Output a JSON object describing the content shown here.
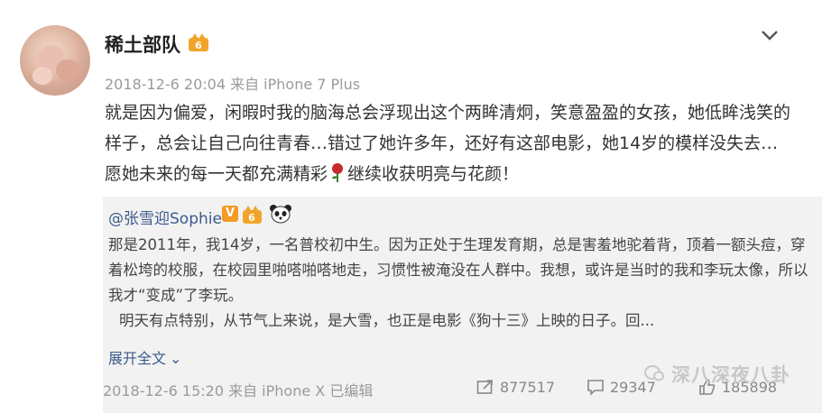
{
  "post": {
    "username": "稀土部队",
    "meta": "2018-12-6 20:04 来自 iPhone 7 Plus",
    "content_before_rose": "就是因为偏爱，闲暇时我的脑海总会浮现出这个两眸清炯，笑意盈盈的女孩，她低眸浅笑的样子，总会让自己向往青春…错过了她许多年，还好有这部电影，她14岁的模样没失去…愿她未来的每一天都充满精彩",
    "content_after_rose": "继续收获明亮与花颜！",
    "icons": [
      "vip-icon",
      "chevron-down-icon",
      "rose-icon"
    ]
  },
  "repost": {
    "username": "@张雪迎Sophie",
    "v_badge": "V",
    "text_1": "那是2011年，我14岁，一名普校初中生。因为正处于生理发育期，总是害羞地驼着背，顶着一额头痘，穿着松垮的校服，在校园里啪嗒啪嗒地走，习惯性被淹没在人群中。我想，或许是当时的我和李玩太像，所以我才“变成”了李玩。",
    "text_2": "明天有点特别，从节气上来说，是大雪，也正是电影《狗十三》上映的日子。回...",
    "expand_label": "展开全文",
    "expand_arrow": "⌄",
    "meta": "2018-12-6 15:20 来自 iPhone X  已编辑",
    "reposts": "877517",
    "comments": "29347",
    "likes": "185898",
    "watermark": "深八深夜八卦",
    "icons": [
      "vip-icon",
      "panda-icon",
      "repost-icon",
      "comment-icon",
      "like-icon",
      "watermark-icon"
    ],
    "accent": "#3a5b8c",
    "v_color": "#f59a23"
  }
}
